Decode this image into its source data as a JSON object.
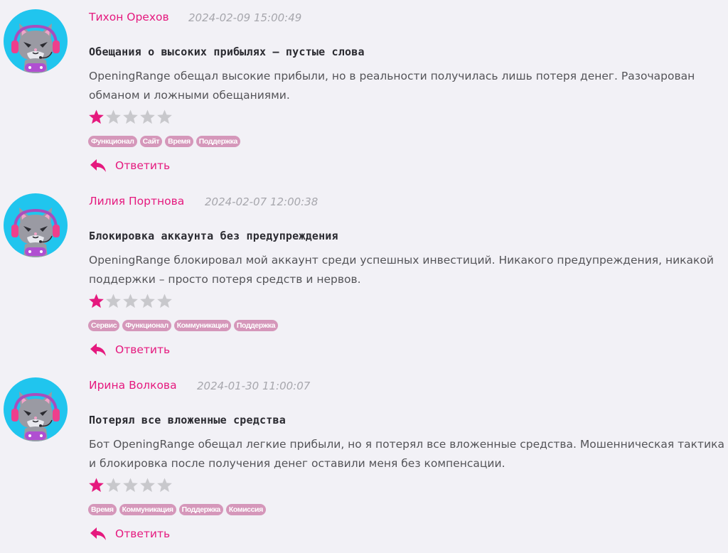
{
  "colors": {
    "accent": "#e5197e",
    "avatar_bg": "#20c5ee",
    "tag_bg": "#d597ba",
    "star_empty": "#c8c8cc",
    "background": "#f2f1f6"
  },
  "icons": {
    "avatar": "cat-gamer-avatar-icon",
    "star": "star-icon",
    "reply": "reply-arrow-icon"
  },
  "reviews": [
    {
      "author": "Тихон Орехов",
      "date": "2024-02-09 15:00:49",
      "title": "Обещания о высоких прибылях – пустые слова",
      "text": "OpeningRange обещал высокие прибыли, но в реальности получилась лишь потеря денег. Разочарован обманом и ложными обещаниями.",
      "rating": 1,
      "rating_max": 5,
      "tags": [
        "Функционал",
        "Сайт",
        "Время",
        "Поддержка"
      ],
      "reply_label": "Ответить"
    },
    {
      "author": "Лилия Портнова",
      "date": "2024-02-07 12:00:38",
      "title": "Блокировка аккаунта без предупреждения",
      "text": "OpeningRange блокировал мой аккаунт среди успешных инвестиций. Никакого предупреждения, никакой поддержки – просто потеря средств и нервов.",
      "rating": 1,
      "rating_max": 5,
      "tags": [
        "Сервис",
        "Функционал",
        "Коммуникация",
        "Поддержка"
      ],
      "reply_label": "Ответить"
    },
    {
      "author": "Ирина Волкова",
      "date": "2024-01-30 11:00:07",
      "title": "Потерял все вложенные средства",
      "text": "Бот OpeningRange обещал легкие прибыли, но я потерял все вложенные средства. Мошенническая тактика и блокировка после получения денег оставили меня без компенсации.",
      "rating": 1,
      "rating_max": 5,
      "tags": [
        "Время",
        "Коммуникация",
        "Поддержка",
        "Комиссия"
      ],
      "reply_label": "Ответить"
    }
  ]
}
